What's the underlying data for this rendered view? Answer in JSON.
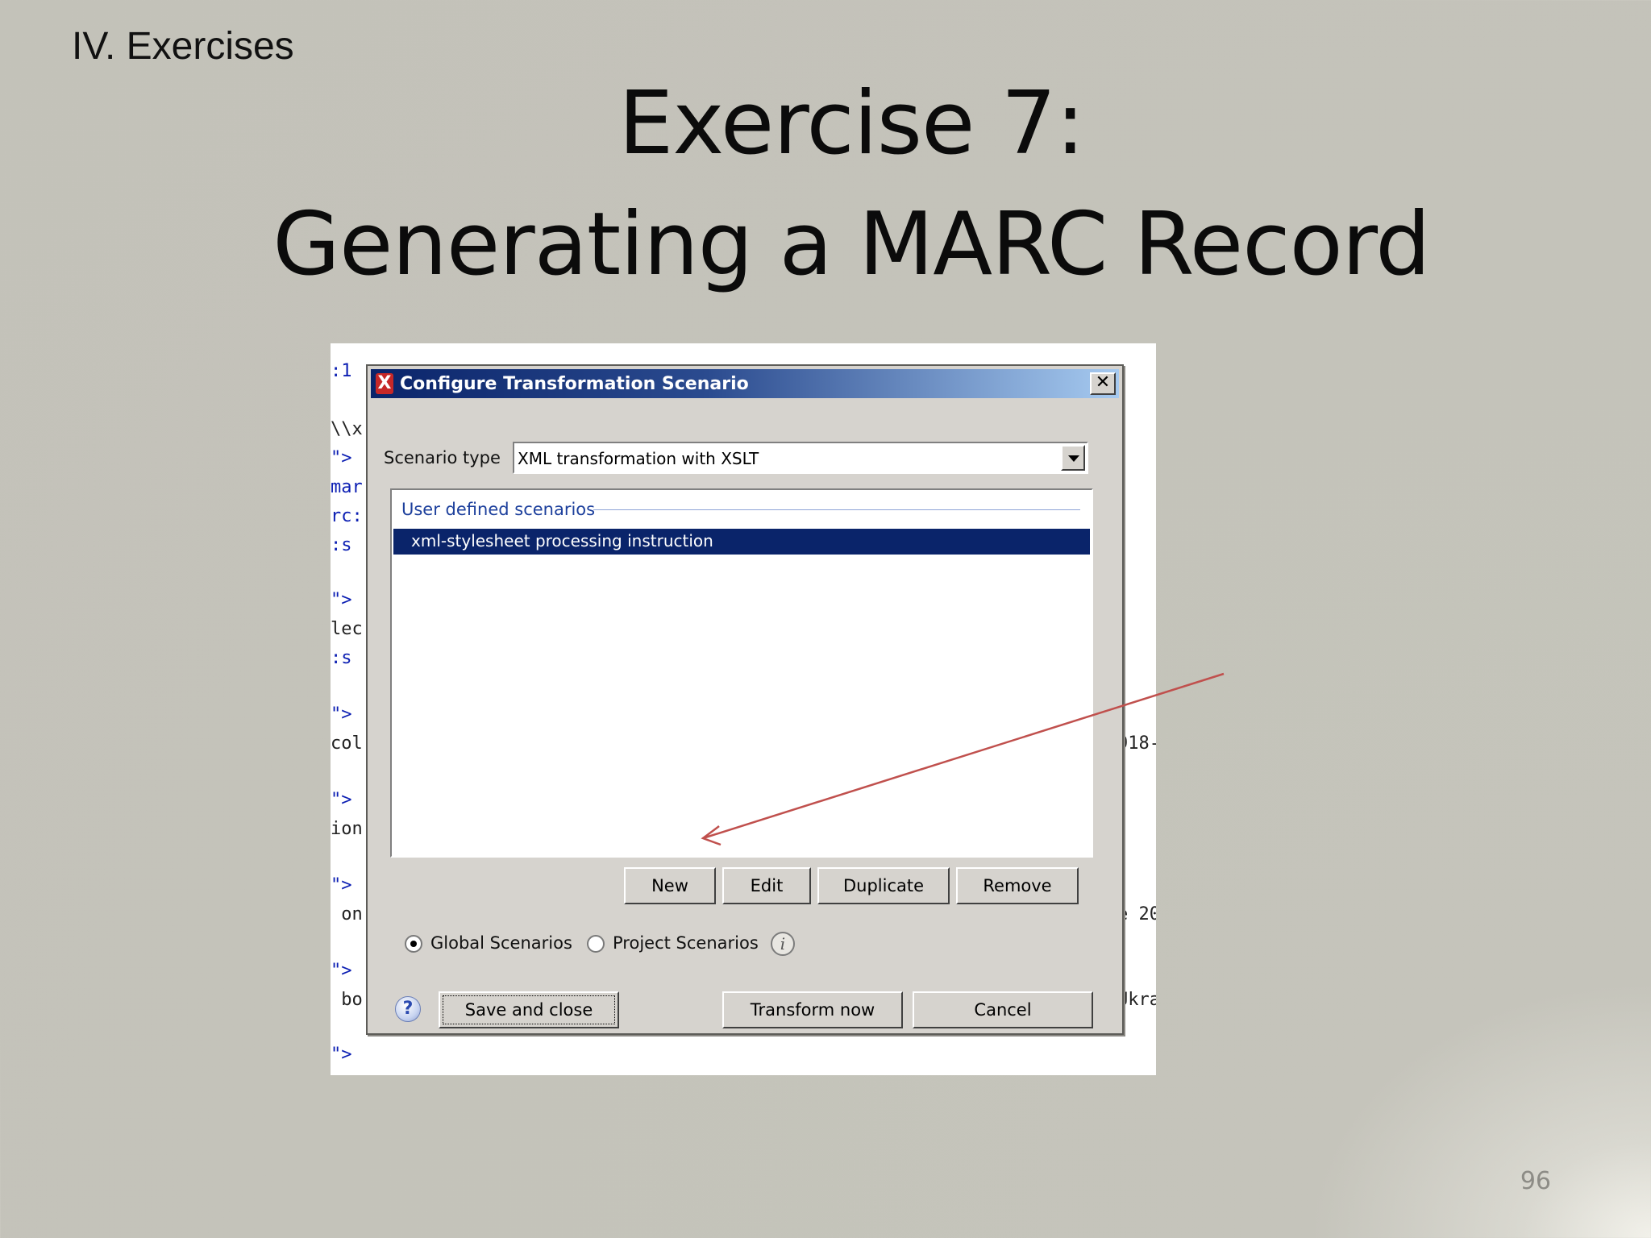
{
  "slide": {
    "section_label": "IV. Exercises",
    "title_line1": "Exercise 7:",
    "title_line2": "Generating a MARC Record",
    "page_number": "96"
  },
  "background_code": {
    "left_lines": [
      ":1",
      "\\\\x",
      "\">",
      "mar",
      "rc:",
      ":s",
      "\">",
      "lec",
      ":s",
      "\">",
      "col",
      "\">",
      "ion",
      "\">",
      " on",
      "\">",
      " bo",
      "\">"
    ],
    "right_lines": [
      "918-",
      "e 20",
      "Ukra"
    ]
  },
  "dialog": {
    "title": "Configure Transformation Scenario",
    "close_glyph": "✕",
    "scenario_type_label": "Scenario type",
    "scenario_type_value": "XML transformation with XSLT",
    "group_label": "User defined scenarios",
    "scenarios": [
      "xml-stylesheet processing instruction"
    ],
    "buttons": {
      "new": "New",
      "edit": "Edit",
      "duplicate": "Duplicate",
      "remove": "Remove",
      "save_and_close": "Save and close",
      "transform_now": "Transform now",
      "cancel": "Cancel"
    },
    "radio_global": "Global Scenarios",
    "radio_project": "Project Scenarios",
    "selected_radio": "global"
  },
  "colors": {
    "selection": "#0a246a",
    "arrow": "#c0504d",
    "titlebar_start": "#0a246a",
    "titlebar_end": "#a6caf0"
  },
  "icons": {
    "app": "oxygen-x-icon",
    "info": "info-icon",
    "help": "help-question-icon"
  }
}
